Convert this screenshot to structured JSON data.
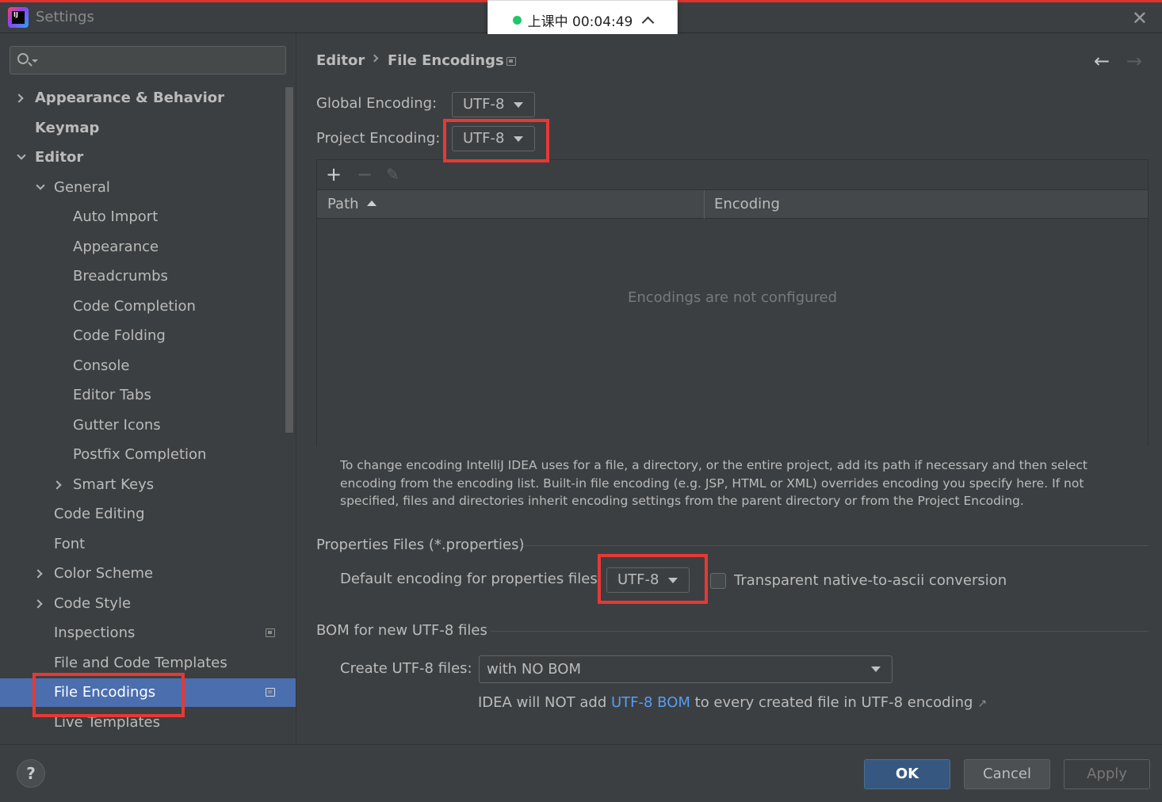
{
  "window": {
    "title": "Settings",
    "app_logo_text": "IJ"
  },
  "timer": {
    "text": "上课中 00:04:49",
    "status_color": "#1fc66b"
  },
  "search": {
    "placeholder": "",
    "value": ""
  },
  "sidebar": {
    "items": [
      {
        "label": "Appearance & Behavior"
      },
      {
        "label": "Keymap"
      },
      {
        "label": "Editor"
      },
      {
        "label": "General"
      },
      {
        "label": "Auto Import"
      },
      {
        "label": "Appearance"
      },
      {
        "label": "Breadcrumbs"
      },
      {
        "label": "Code Completion"
      },
      {
        "label": "Code Folding"
      },
      {
        "label": "Console"
      },
      {
        "label": "Editor Tabs"
      },
      {
        "label": "Gutter Icons"
      },
      {
        "label": "Postfix Completion"
      },
      {
        "label": "Smart Keys"
      },
      {
        "label": "Code Editing"
      },
      {
        "label": "Font"
      },
      {
        "label": "Color Scheme"
      },
      {
        "label": "Code Style"
      },
      {
        "label": "Inspections"
      },
      {
        "label": "File and Code Templates"
      },
      {
        "label": "File Encodings"
      },
      {
        "label": "Live Templates"
      }
    ],
    "selected": "File Encodings"
  },
  "breadcrumb": {
    "parent": "Editor",
    "current": "File Encodings"
  },
  "encodings": {
    "global_label": "Global Encoding:",
    "global_value": "UTF-8",
    "project_label": "Project Encoding:",
    "project_value": "UTF-8"
  },
  "table": {
    "add": "+",
    "remove": "−",
    "edit": "✎",
    "columns": [
      "Path",
      "Encoding"
    ],
    "empty_text": "Encodings are not configured",
    "help": "To change encoding IntelliJ IDEA uses for a file, a directory, or the entire project, add its path if necessary and then select encoding from the encoding list. Built-in file encoding (e.g. JSP, HTML or XML) overrides encoding you specify here. If not specified, files and directories inherit encoding settings from the parent directory or from the Project Encoding."
  },
  "properties": {
    "section_title": "Properties Files (*.properties)",
    "default_label": "Default encoding for properties files:",
    "default_value": "UTF-8",
    "transparent_label": "Transparent native-to-ascii conversion",
    "transparent_checked": false
  },
  "bom": {
    "section_title": "BOM for new UTF-8 files",
    "create_label": "Create UTF-8 files:",
    "create_value": "with NO BOM",
    "note_prefix": "IDEA will NOT add ",
    "note_link": "UTF-8 BOM",
    "note_suffix": " to every created file in UTF-8 encoding"
  },
  "footer": {
    "help": "?",
    "ok": "OK",
    "cancel": "Cancel",
    "apply": "Apply"
  },
  "colors": {
    "accent_selected": "#4b6eaf",
    "highlight_red": "#e53935",
    "link": "#589df6",
    "background": "#3c3f41"
  }
}
